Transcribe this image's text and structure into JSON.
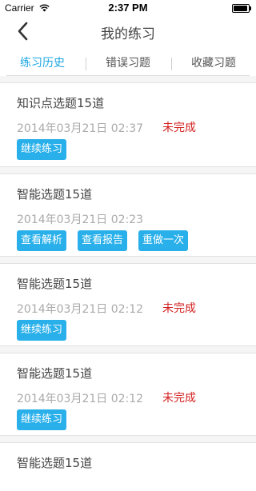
{
  "status_bar": {
    "carrier": "Carrier",
    "time": "2:37 PM"
  },
  "nav": {
    "title": "我的练习",
    "back_icon": "chevron-left-icon"
  },
  "tabs": [
    {
      "label": "练习历史",
      "active": true
    },
    {
      "label": "错误习题",
      "active": false
    },
    {
      "label": "收藏习题",
      "active": false
    }
  ],
  "records": [
    {
      "title": "知识点选题15道",
      "time": "2014年03月21日 02:37",
      "status": "未完成",
      "buttons": [
        "继续练习"
      ]
    },
    {
      "title": "智能选题15道",
      "time": "2014年03月21日 02:23",
      "status": "",
      "buttons": [
        "查看解析",
        "查看报告",
        "重做一次"
      ]
    },
    {
      "title": "智能选题15道",
      "time": "2014年03月21日 02:12",
      "status": "未完成",
      "buttons": [
        "继续练习"
      ]
    },
    {
      "title": "智能选题15道",
      "time": "2014年03月21日 02:12",
      "status": "未完成",
      "buttons": [
        "继续练习"
      ]
    },
    {
      "title": "智能选题15道",
      "time": "",
      "status": "",
      "buttons": []
    }
  ],
  "colors": {
    "accent": "#1ea7e1",
    "button": "#29b0ea",
    "status_incomplete": "#d31f1f"
  }
}
